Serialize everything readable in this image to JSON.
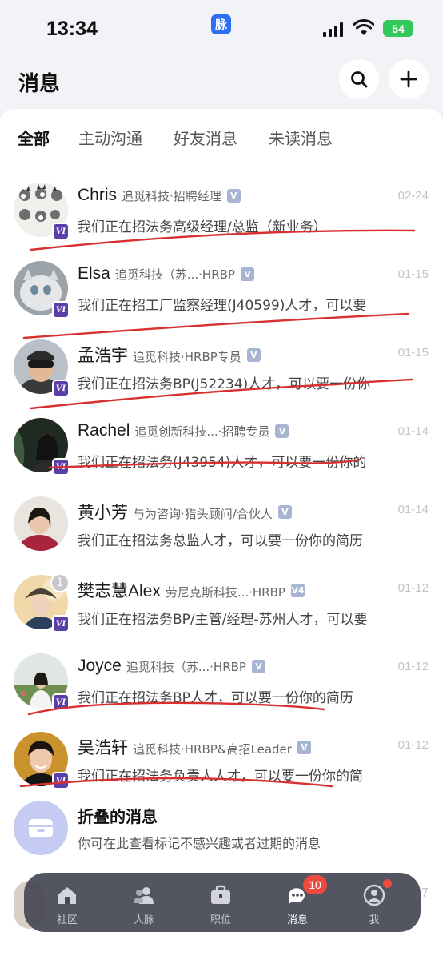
{
  "status_bar": {
    "time": "13:34",
    "app_label": "脉",
    "battery": "54"
  },
  "header": {
    "title": "消息",
    "search_icon": "search-icon",
    "add_icon": "plus-icon"
  },
  "tabs": [
    {
      "label": "全部",
      "active": true
    },
    {
      "label": "主动沟通",
      "active": false
    },
    {
      "label": "好友消息",
      "active": false
    },
    {
      "label": "未读消息",
      "active": false
    }
  ],
  "messages": [
    {
      "name": "Chris",
      "company": "追觅科技·招聘经理",
      "verify": "V",
      "date": "02-24",
      "preview": "我们正在招法务高级经理/总监（新业务）",
      "badge": "VI"
    },
    {
      "name": "Elsa",
      "company": "追觅科技（苏...·HRBP",
      "verify": "V",
      "date": "01-15",
      "preview": "我们正在招工厂监察经理(J40599)人才，可以要",
      "badge": "VI"
    },
    {
      "name": "孟浩宇",
      "company": "追觅科技·HRBP专员",
      "verify": "V",
      "date": "01-15",
      "preview": "我们正在招法务BP(J52234)人才，可以要一份你",
      "badge": "VI"
    },
    {
      "name": "Rachel",
      "company": "追觅创新科技...·招聘专员",
      "verify": "V",
      "date": "01-14",
      "preview": "我们正在招法务(J43954)人才，可以要一份你的",
      "badge": "VI"
    },
    {
      "name": "黄小芳",
      "company": "与为咨询·猎头顾问/合伙人",
      "verify": "V",
      "date": "01-14",
      "preview": "我们正在招法务总监人才，可以要一份你的简历",
      "badge": ""
    },
    {
      "name": "樊志慧Alex",
      "company": "劳尼克斯科技...·HRBP",
      "verify": "V4",
      "date": "01-12",
      "preview": "我们正在招法务BP/主管/经理-苏州人才，可以要",
      "badge": "VI",
      "unread": "1"
    },
    {
      "name": "Joyce",
      "company": "追觅科技（苏...·HRBP",
      "verify": "V",
      "date": "01-12",
      "preview": "我们正在招法务BP人才，可以要一份你的简历",
      "badge": "VI"
    },
    {
      "name": "吴浩轩",
      "company": "追觅科技·HRBP&高招Leader",
      "verify": "V",
      "date": "01-12",
      "preview": "我们正在招法务负责人人才，可以要一份你的简",
      "badge": "VI"
    }
  ],
  "folded": {
    "title": "折叠的消息",
    "subtitle": "你可在此查看标记不感兴趣或者过期的消息"
  },
  "peek": {
    "date": "7"
  },
  "bottom_nav": [
    {
      "label": "社区",
      "icon": "home-icon"
    },
    {
      "label": "人脉",
      "icon": "contacts-icon"
    },
    {
      "label": "职位",
      "icon": "briefcase-icon"
    },
    {
      "label": "消息",
      "icon": "chat-icon",
      "badge": "10",
      "active": true
    },
    {
      "label": "我",
      "icon": "profile-icon",
      "dot": true
    }
  ]
}
